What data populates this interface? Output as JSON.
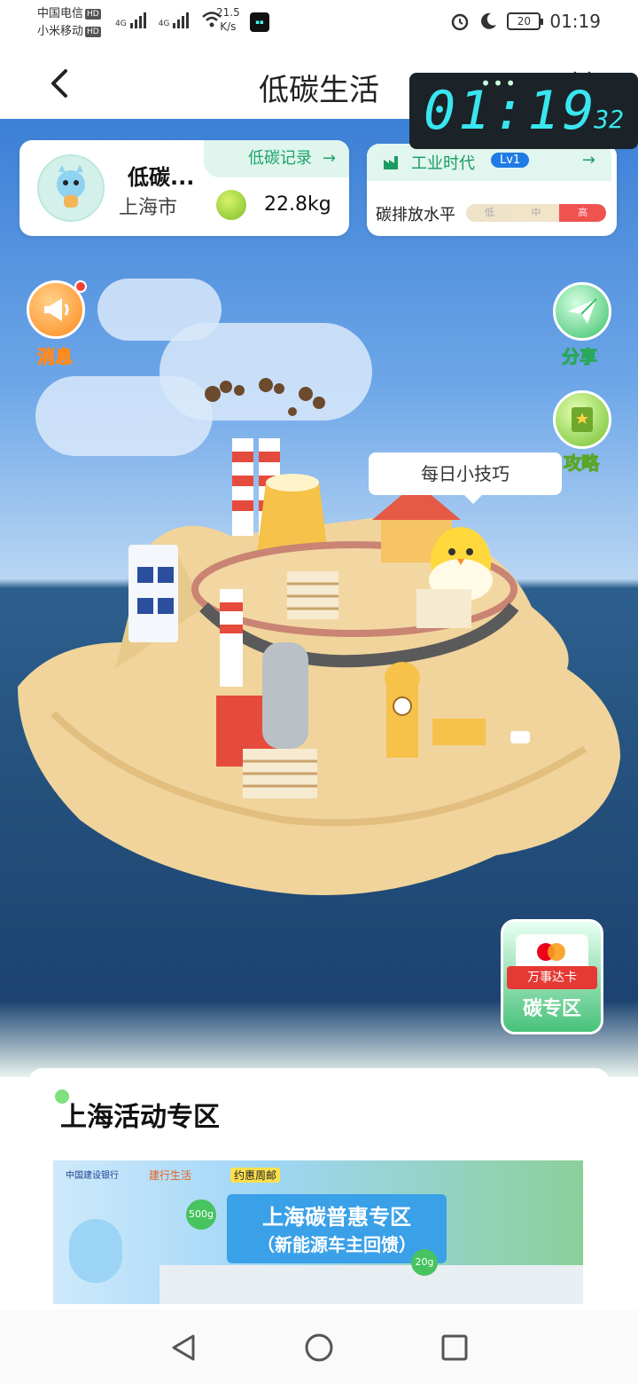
{
  "status": {
    "carrier1": "中国电信",
    "carrier2": "小米移动",
    "hd": "HD",
    "net1": "4G",
    "net2": "4G",
    "speed_value": "21.5",
    "speed_unit": "K/s",
    "battery": "20",
    "time": "01:19"
  },
  "titlebar": {
    "title": "低碳生活"
  },
  "clock": {
    "hm": "01:19",
    "sec": "32"
  },
  "profile": {
    "name": "低碳...",
    "city": "上海市",
    "record_label": "低碳记录",
    "record_arrow": "→",
    "carbon_kg": "22.8kg"
  },
  "industry": {
    "era": "工业时代",
    "level": "Lv1",
    "arrow": "→",
    "emission_label": "碳排放水平",
    "levels": [
      "低",
      "中",
      "高"
    ]
  },
  "side_buttons": {
    "message": "消息",
    "share": "分享",
    "guide": "攻略"
  },
  "tips": "每日小技巧",
  "carbon_zone": {
    "card_brand": "万事达卡",
    "label": "碳专区"
  },
  "activity": {
    "title": "上海活动专区",
    "banner": {
      "bank": "中国建设银行",
      "life": "建行生活",
      "tag": "约惠周邮",
      "line1": "上海碳普惠专区",
      "line2": "（新能源车主回馈）",
      "badge1": "500g",
      "badge2": "20g"
    }
  },
  "colors": {
    "accent_green": "#1fa36b",
    "level_blue": "#1f7be6",
    "high_red": "#ef5350",
    "orange": "#ff8a1e"
  }
}
